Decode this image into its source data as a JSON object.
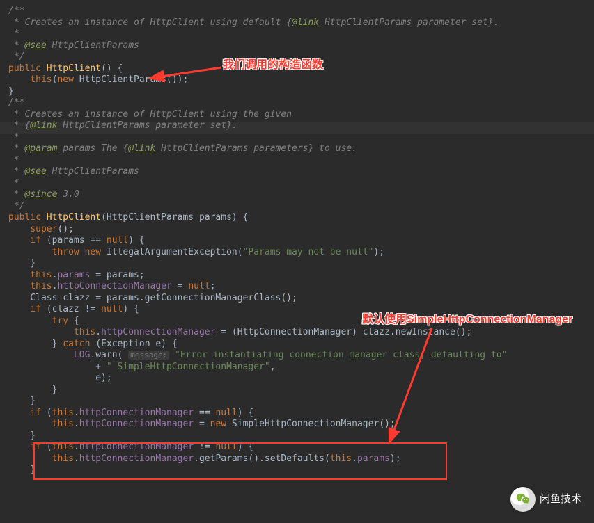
{
  "annotations": {
    "label1": "我们调用的构造函数",
    "label2": "默认使用SimpleHttpConnectionManager"
  },
  "watermark": {
    "text": "闲鱼技术"
  },
  "code": {
    "c1": "/**",
    "c2a": " * Creates an instance of HttpClient using default {",
    "c2b": "@link",
    "c2c": " HttpClientParams parameter set}.",
    "c3": " *",
    "c4a": " * ",
    "c4b": "@see",
    "c4c": " HttpClientParams",
    "c5": " */",
    "l6a": "public",
    "l6b": " HttpClient",
    "l6c": "() {",
    "l7a": "    ",
    "l7b": "this",
    "l7c": "(",
    "l7d": "new",
    "l7e": " HttpClientParams());",
    "l8": "}",
    "blank": "",
    "c10": "/**",
    "c11": " * Creates an instance of HttpClient using the given",
    "c12a": " * {",
    "c12b": "@link",
    "c12c": " HttpClientParams parameter set}.",
    "c13": " *",
    "c14a": " * ",
    "c14b": "@param",
    "c14c": " params The {",
    "c14d": "@link",
    "c14e": " HttpClientParams parameters} to use.",
    "c15": " *",
    "c16a": " * ",
    "c16b": "@see",
    "c16c": " HttpClientParams",
    "c17": " *",
    "c18a": " * ",
    "c18b": "@since",
    "c18c": " 3.0",
    "c19": " */",
    "l20a": "public",
    "l20b": " HttpClient",
    "l20c": "(HttpClientParams params) {",
    "l21a": "    ",
    "l21b": "super",
    "l21c": "();",
    "l22a": "    ",
    "l22b": "if",
    "l22c": " (params == ",
    "l22d": "null",
    "l22e": ") {",
    "l23a": "        ",
    "l23b": "throw new",
    "l23c": " IllegalArgumentException(",
    "l23d": "\"Params may not be null\"",
    "l23e": ");",
    "l24": "    }",
    "l25a": "    ",
    "l25b": "this",
    "l25c": ".",
    "l25d": "params",
    "l25e": " = params;",
    "l26a": "    ",
    "l26b": "this",
    "l26c": ".",
    "l26d": "httpConnectionManager",
    "l26e": " = ",
    "l26f": "null",
    "l26g": ";",
    "l27a": "    Class clazz = params.getConnectionManagerClass();",
    "l28a": "    ",
    "l28b": "if",
    "l28c": " (clazz != ",
    "l28d": "null",
    "l28e": ") {",
    "l29a": "        ",
    "l29b": "try",
    "l29c": " {",
    "l30a": "            ",
    "l30b": "this",
    "l30c": ".",
    "l30d": "httpConnectionManager",
    "l30e": " = (HttpConnectionManager) clazz.newInstance();",
    "l31a": "        } ",
    "l31b": "catch",
    "l31c": " (Exception e) {",
    "l32a": "            ",
    "l32b": "LOG",
    "l32c": ".warn( ",
    "l32hint": "message:",
    "l32d": " ",
    "l32e": "\"Error instantiating connection manager class, defaulting to\"",
    "l33a": "                + ",
    "l33b": "\" SimpleHttpConnectionManager\"",
    "l33c": ",",
    "l34a": "                e);",
    "l35": "        }",
    "l36": "    }",
    "l37a": "    ",
    "l37b": "if",
    "l37c": " (",
    "l37d": "this",
    "l37e": ".",
    "l37f": "httpConnectionManager",
    "l37g": " == ",
    "l37h": "null",
    "l37i": ") {",
    "l38a": "        ",
    "l38b": "this",
    "l38c": ".",
    "l38d": "httpConnectionManager",
    "l38e": " = ",
    "l38f": "new",
    "l38g": " SimpleHttpConnectionManager();",
    "l39": "    }",
    "l40a": "    ",
    "l40b": "if",
    "l40c": " (",
    "l40d": "this",
    "l40e": ".",
    "l40f": "httpConnectionManager",
    "l40g": " != ",
    "l40h": "null",
    "l40i": ") {",
    "l41a": "        ",
    "l41b": "this",
    "l41c": ".",
    "l41d": "httpConnectionManager",
    "l41e": ".getParams().setDefaults(",
    "l41f": "this",
    "l41g": ".",
    "l41h": "params",
    "l41i": ");",
    "l42": "    }"
  }
}
